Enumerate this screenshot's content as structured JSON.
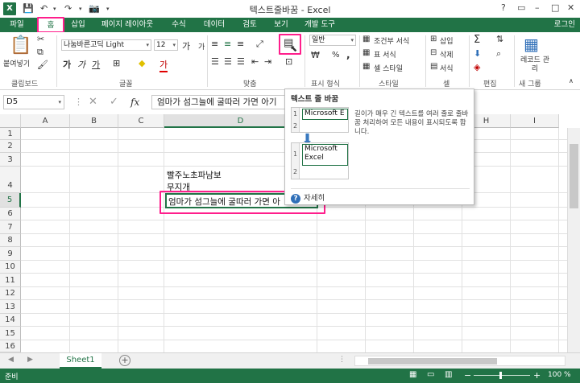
{
  "app": {
    "logo_letter": "X",
    "window_title": "텍스트줄바꿈 - Excel",
    "login": "로그인",
    "window_controls": [
      "?",
      "▭",
      "–",
      "□",
      "✕"
    ]
  },
  "ribbon_tabs": [
    "파일",
    "홈",
    "삽입",
    "페이지 레이아웃",
    "수식",
    "데이터",
    "검토",
    "보기",
    "개발 도구"
  ],
  "ribbon": {
    "clipboard": {
      "paste": "붙여넣기",
      "label": "클립보드"
    },
    "font": {
      "name": "나눔바른고딕 Light",
      "size": "12",
      "grow": "가",
      "shrink": "가",
      "bold": "가",
      "italic": "가",
      "underline": "가",
      "font_color_glyph": "가",
      "label": "글꼴"
    },
    "alignment": {
      "label": "맞춤"
    },
    "number": {
      "format": "일반",
      "percent": "%",
      "comma": ",",
      "label": "표시 형식"
    },
    "styles": {
      "conditional": "조건부 서식",
      "table": "표 서식",
      "cell": "셀 스타일",
      "label": "스타일"
    },
    "cells": {
      "insert": "삽입",
      "delete": "삭제",
      "format": "서식",
      "label": "셀"
    },
    "editing": {
      "sum": "Σ",
      "label": "편집"
    },
    "new_group": {
      "template": "레코드 관리",
      "label": "새 그룹"
    }
  },
  "formula_bar": {
    "name_box": "D5",
    "fx": "fx",
    "value": "엄마가 섬그늘에 굴따러 가면 아기"
  },
  "grid": {
    "columns": [
      "A",
      "B",
      "C",
      "D",
      "E",
      "F",
      "G",
      "H",
      "I"
    ],
    "rows": [
      "1",
      "2",
      "3",
      "4",
      "5",
      "6",
      "7",
      "8",
      "9",
      "10",
      "11",
      "12",
      "13",
      "14",
      "15",
      "16"
    ],
    "cells": {
      "D4_line1": "빨주노초파남보",
      "D4_line2": "무지개",
      "D5": "엄마가 섬그늘에 굴따러 가면 아"
    }
  },
  "tooltip": {
    "title": "텍스트 줄 바꿈",
    "description": "길이가 매우 긴 텍스트를 여러 줄로 줄바꿈 처리하여 모든 내용이 표시되도록 합니다.",
    "before": {
      "row1": "1",
      "row2": "2",
      "cell": "Microsoft E"
    },
    "after": {
      "row1": "1",
      "row2": "2",
      "line1": "Microsoft",
      "line2": "Excel"
    },
    "help": "자세히"
  },
  "sheets": [
    "Sheet1"
  ],
  "add_sheet": "+",
  "status": {
    "ready": "준비",
    "zoom": "100 %",
    "minus": "−",
    "plus": "+"
  },
  "colors": {
    "excel_green": "#217346",
    "highlight": "#ff1e8c",
    "help_blue": "#2f6fb8"
  }
}
